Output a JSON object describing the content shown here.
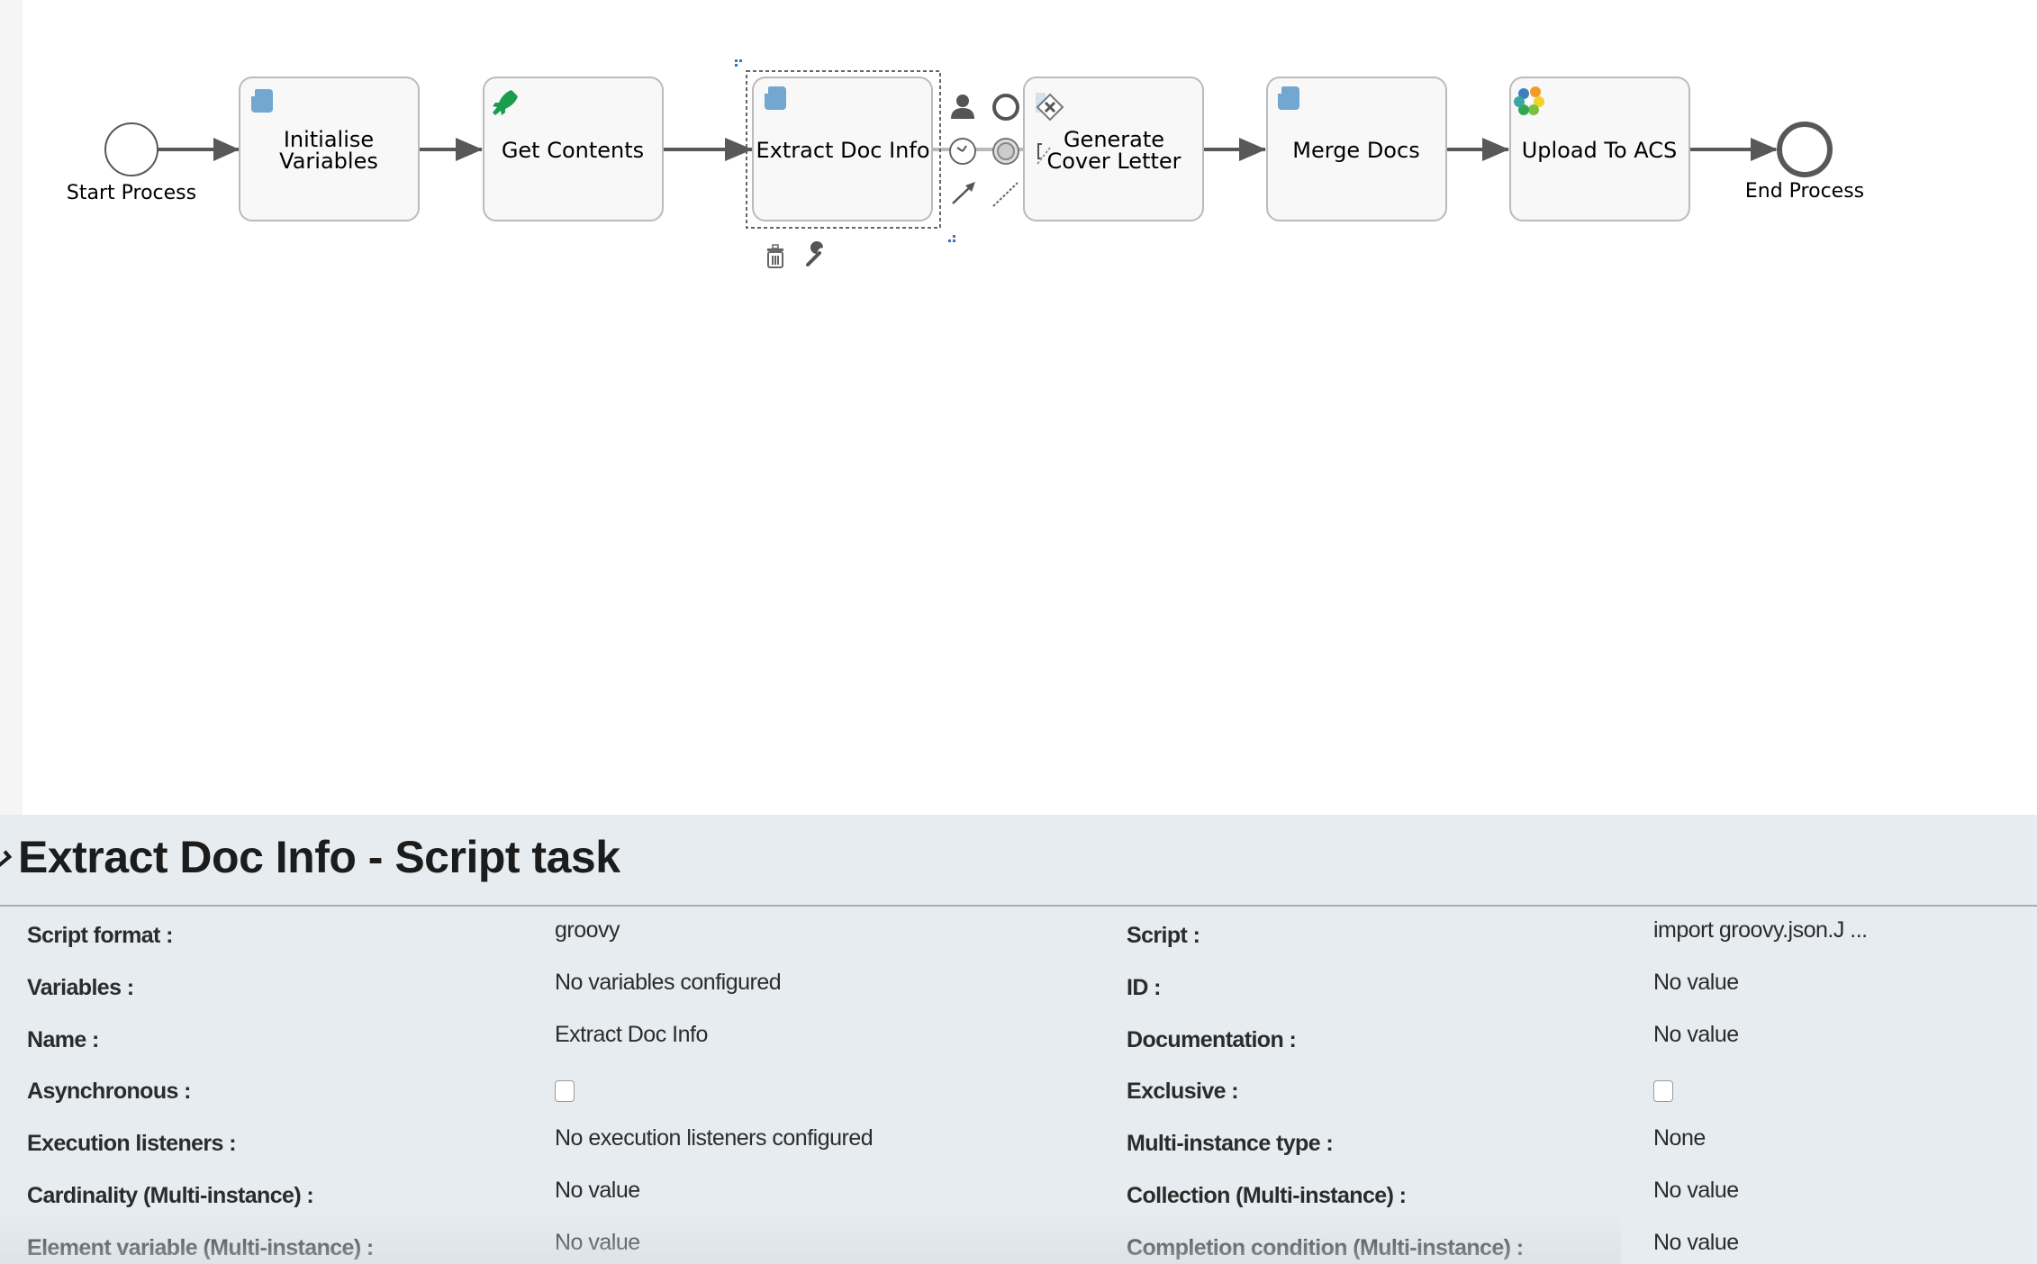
{
  "diagram": {
    "start_event": {
      "label": "Start Process"
    },
    "end_event": {
      "label": "End Process"
    },
    "tasks": [
      {
        "label_lines": [
          "Initialise",
          "Variables"
        ],
        "icon": "script-task-icon",
        "selected": false
      },
      {
        "label_lines": [
          "Get Contents"
        ],
        "icon": "rocket-service-task-icon",
        "selected": false
      },
      {
        "label_lines": [
          "Extract Doc Info"
        ],
        "icon": "script-task-icon",
        "selected": true
      },
      {
        "label_lines": [
          "Generate",
          "Cover Letter"
        ],
        "icon": "none",
        "selected": false
      },
      {
        "label_lines": [
          "Merge Docs"
        ],
        "icon": "script-task-icon",
        "selected": false
      },
      {
        "label_lines": [
          "Upload To ACS"
        ],
        "icon": "alfresco-flower-icon",
        "selected": false
      }
    ],
    "quick_menu": {
      "items": [
        "user-task-icon",
        "end-event-icon",
        "gateway-icon",
        "timer-event-icon",
        "intermediate-event-icon",
        "annotation-icon",
        "sequence-flow-icon",
        "association-icon"
      ],
      "actions": [
        "delete-icon",
        "wrench-icon"
      ]
    },
    "colors": {
      "task_fill": "#f8f8f8",
      "task_stroke": "#bbbbbb",
      "flow": "#585858",
      "script_icon": "#72a7d0",
      "rocket_icon": "#1a9d4f"
    }
  },
  "properties_panel": {
    "title": "Extract Doc Info - Script task",
    "rows": [
      {
        "left_label": "Script format :",
        "left_value": "groovy",
        "right_label": "Script :",
        "right_value": "import groovy.json.J ..."
      },
      {
        "left_label": "Variables :",
        "left_value": "No variables configured",
        "right_label": "ID :",
        "right_value": "No value"
      },
      {
        "left_label": "Name :",
        "left_value": "Extract Doc Info",
        "right_label": "Documentation :",
        "right_value": "No value"
      },
      {
        "left_label": "Asynchronous :",
        "left_value": "",
        "left_checkbox": false,
        "right_label": "Exclusive :",
        "right_value": "",
        "right_checkbox": false
      },
      {
        "left_label": "Execution listeners :",
        "left_value": "No execution listeners configured",
        "right_label": "Multi-instance type :",
        "right_value": "None"
      },
      {
        "left_label": "Cardinality (Multi-instance) :",
        "left_value": "No value",
        "right_label": "Collection (Multi-instance) :",
        "right_value": "No value"
      },
      {
        "left_label": "Element variable (Multi-instance) :",
        "left_value": "No value",
        "right_label": "Completion condition (Multi-instance) :",
        "right_value": "No value"
      }
    ]
  }
}
